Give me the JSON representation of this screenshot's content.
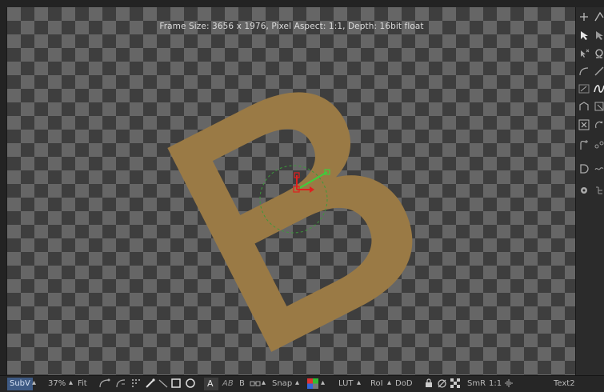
{
  "viewer": {
    "frame_info": "Frame Size: 3656 x 1976, Pixel Aspect: 1:1, Depth: 16bit float",
    "letter": "B",
    "letter_color": "#9a7a45",
    "checker_dark": "#3e3e3e",
    "checker_light": "#666666",
    "gizmo_colors": {
      "x_axis": "#e01f1f",
      "y_axis": "#3ccf3c",
      "circle": "#3a9a3a"
    }
  },
  "right_toolbar": {
    "tools": [
      "plus-icon",
      "polyline-icon",
      "select-arrow-icon",
      "arrow-icon",
      "arrow-x-icon",
      "omega-icon",
      "curve-icon",
      "line-icon",
      "smooth-icon",
      "bspline-icon",
      "warp-icon",
      "bbox-icon",
      "delete-point-icon",
      "rotate-icon",
      "add-point-icon",
      "keyframe-icon",
      "d-icon",
      "tilde-icon",
      "visibility-icon",
      "hierarchy-icon"
    ]
  },
  "bottom_bar": {
    "subv": "SubV",
    "zoom": "37%",
    "fit": "Fit",
    "a_label": "A",
    "ab_label": "AB",
    "b_label": "B",
    "snap": "Snap",
    "lut": "LUT",
    "roi": "RoI",
    "dod": "DoD",
    "smr": "SmR",
    "ratio": "1:1",
    "node_name": "Text2"
  }
}
